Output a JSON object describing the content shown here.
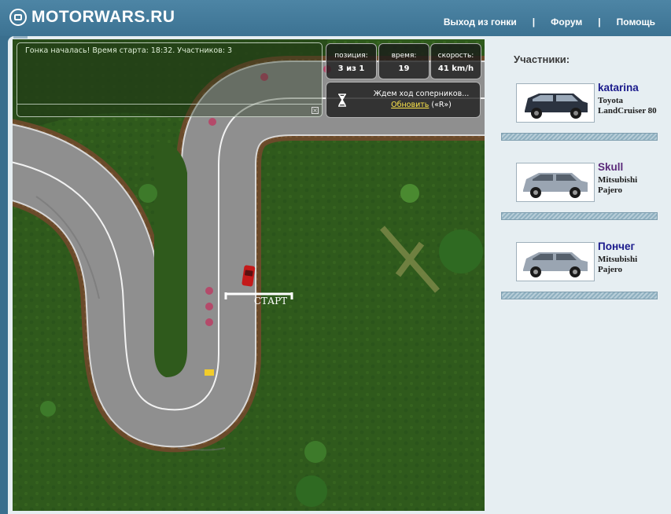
{
  "header": {
    "logo_text": "MOTORWARS.RU",
    "nav": [
      {
        "label": "Выход из гонки"
      },
      {
        "label": "Форум"
      },
      {
        "label": "Помощь"
      }
    ],
    "separator": "|"
  },
  "hud": {
    "message": "Гонка началась! Время старта: 18:32. Участников: 3",
    "close_glyph": "×",
    "position": {
      "label": "позиция:",
      "value": "3 из 1"
    },
    "time": {
      "label": "время:",
      "value": "19"
    },
    "speed": {
      "label": "скорость:",
      "value": "41 km/h"
    },
    "wait_text": "Ждем ход соперников...",
    "refresh_label": "Обновить",
    "refresh_hotkey": "(«R»)"
  },
  "track": {
    "start_label": "СТАРТ"
  },
  "sidebar": {
    "title": "Участники:",
    "participants": [
      {
        "name": "katarina",
        "name_color": "#1a1a8c",
        "car": "Toyota LandCruiser 80",
        "car_color": "#2b3340"
      },
      {
        "name": "Skull",
        "name_color": "#5b2a7a",
        "car": "Mitsubishi Pajero",
        "car_color": "#9aa5b2"
      },
      {
        "name": "Пончег",
        "name_color": "#1a1a8c",
        "car": "Mitsubishi Pajero",
        "car_color": "#9aa5b2"
      }
    ]
  },
  "colors": {
    "header_bg": "#3c7292",
    "panel_bg": "#e6eef2",
    "grass": "#2f5a1c",
    "road": "#8a8a8a",
    "player_car": "#c41a1a",
    "refresh_link": "#ffe64a"
  }
}
